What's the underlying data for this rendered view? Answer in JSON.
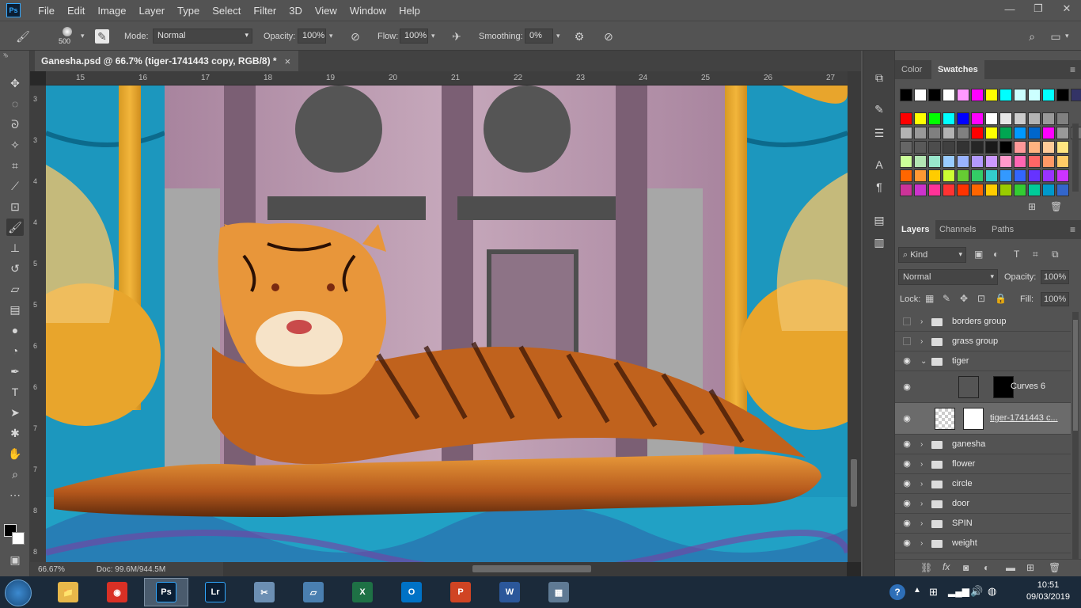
{
  "app": {
    "logo_text": "Ps"
  },
  "menu": [
    "File",
    "Edit",
    "Image",
    "Layer",
    "Type",
    "Select",
    "Filter",
    "3D",
    "View",
    "Window",
    "Help"
  ],
  "window_controls": {
    "minimize": "—",
    "restore": "❐",
    "close": "✕"
  },
  "options": {
    "brush_size": "500",
    "mode_label": "Mode:",
    "mode_value": "Normal",
    "opacity_label": "Opacity:",
    "opacity_value": "100%",
    "flow_label": "Flow:",
    "flow_value": "100%",
    "smoothing_label": "Smoothing:",
    "smoothing_value": "0%"
  },
  "document": {
    "tab_title": "Ganesha.psd @ 66.7% (tiger-1741443 copy, RGB/8) *",
    "close": "×",
    "ruler_top": [
      "15",
      "16",
      "17",
      "18",
      "19",
      "20",
      "21",
      "22",
      "23",
      "24",
      "25",
      "26",
      "27"
    ],
    "ruler_left": [
      "3",
      "3",
      "4",
      "4",
      "5",
      "5",
      "6",
      "6",
      "7",
      "7",
      "8",
      "8"
    ]
  },
  "status": {
    "zoom": "66.67%",
    "doc_size": "Doc: 99.6M/944.5M"
  },
  "color_panel": {
    "tabs": [
      "Color",
      "Swatches"
    ],
    "active_tab": "Swatches",
    "swatch_rows": [
      [
        "#000000",
        "#ffffff",
        "#000000",
        "#ffffff",
        "#ff99ff",
        "#ff00ff",
        "#ffff00",
        "#00ffff",
        "#ccffff",
        "#ccffff",
        "#00ffff",
        "#000000",
        "#333366",
        "#334488"
      ],
      [
        "#ff0000",
        "#ffff00",
        "#00ff00",
        "#00ffff",
        "#0000ff",
        "#ff00ff",
        "#ffffff",
        "#e6e6e6",
        "#cccccc",
        "#b3b3b3",
        "#999999",
        "#808080"
      ],
      [
        "#b3b3b3",
        "#999999",
        "#808080",
        "#b3b3b3",
        "#808080",
        "#ff0000",
        "#ffff00",
        "#00a651",
        "#0099ff",
        "#0066cc",
        "#ff00ff",
        "#999999",
        "#777777"
      ],
      [
        "#666666",
        "#595959",
        "#4d4d4d",
        "#404040",
        "#333333",
        "#262626",
        "#1a1a1a",
        "#000000",
        "#ff9999",
        "#ffb380",
        "#ffcc99",
        "#ffe680"
      ],
      [
        "#ccff99",
        "#b3e6b3",
        "#99e6cc",
        "#99ccff",
        "#99b3ff",
        "#b399ff",
        "#cc99ff",
        "#ff99cc",
        "#ff66b3",
        "#ff6666",
        "#ff9966",
        "#ffcc66"
      ],
      [
        "#ff6600",
        "#ff9933",
        "#ffcc00",
        "#ccff33",
        "#66cc33",
        "#33cc66",
        "#33cccc",
        "#3399ff",
        "#3366ff",
        "#6633ff",
        "#9933ff",
        "#cc33ff"
      ],
      [
        "#cc3399",
        "#cc33cc",
        "#ff3399",
        "#ff3333",
        "#ff3300",
        "#ff6600",
        "#ffcc00",
        "#99cc00",
        "#33cc33",
        "#00cc99",
        "#0099cc",
        "#3366cc"
      ]
    ]
  },
  "layers_panel": {
    "tabs": [
      "Layers",
      "Channels",
      "Paths"
    ],
    "active_tab": "Layers",
    "filter_kind": "Kind",
    "blend_mode": "Normal",
    "opacity_label": "Opacity:",
    "opacity_value": "100%",
    "lock_label": "Lock:",
    "fill_label": "Fill:",
    "fill_value": "100%",
    "layers": [
      {
        "name": "borders group",
        "visible": false,
        "type": "group",
        "expanded": false
      },
      {
        "name": "grass group",
        "visible": false,
        "type": "group",
        "expanded": false
      },
      {
        "name": "tiger",
        "visible": true,
        "type": "group",
        "expanded": true
      },
      {
        "name": "Curves 6",
        "visible": true,
        "type": "adjustment"
      },
      {
        "name": "tiger-1741443 c...",
        "visible": true,
        "type": "layer",
        "selected": true
      },
      {
        "name": "ganesha",
        "visible": true,
        "type": "group",
        "expanded": false
      },
      {
        "name": "flower",
        "visible": true,
        "type": "group",
        "expanded": false
      },
      {
        "name": "circle",
        "visible": true,
        "type": "group",
        "expanded": false
      },
      {
        "name": "door",
        "visible": true,
        "type": "group",
        "expanded": false
      },
      {
        "name": "SPIN",
        "visible": true,
        "type": "group",
        "expanded": false
      },
      {
        "name": "weight",
        "visible": true,
        "type": "group",
        "expanded": false
      }
    ]
  },
  "taskbar": {
    "apps": [
      {
        "name": "Explorer",
        "label": "📁",
        "color": "#e8b84a"
      },
      {
        "name": "Chrome",
        "label": "◉",
        "color": "#d93025"
      },
      {
        "name": "Photoshop",
        "label": "Ps",
        "color": "#0b1e33"
      },
      {
        "name": "Lightroom",
        "label": "Lr",
        "color": "#0b1e33"
      },
      {
        "name": "Snipping",
        "label": "✂",
        "color": "#6c8fb3"
      },
      {
        "name": "Notes",
        "label": "▱",
        "color": "#4a7fb0"
      },
      {
        "name": "Excel",
        "label": "X",
        "color": "#1e7145"
      },
      {
        "name": "Outlook",
        "label": "O",
        "color": "#0072c6"
      },
      {
        "name": "PowerPoint",
        "label": "P",
        "color": "#d04423"
      },
      {
        "name": "Word",
        "label": "W",
        "color": "#2b579a"
      },
      {
        "name": "Calculator",
        "label": "▦",
        "color": "#5f7a94"
      }
    ],
    "time": "10:51",
    "date": "09/03/2019"
  }
}
